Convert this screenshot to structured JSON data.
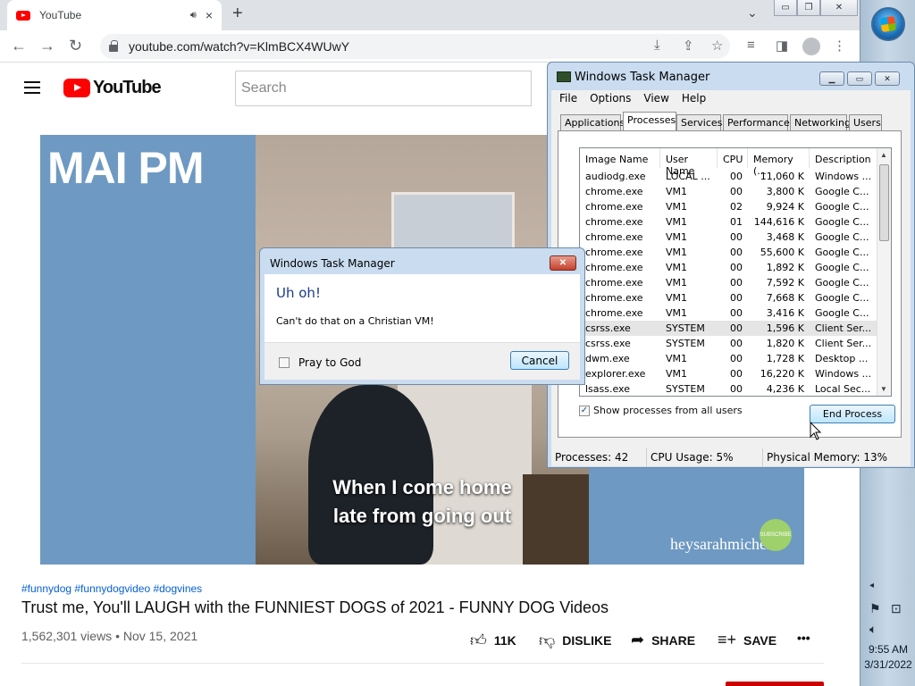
{
  "browser": {
    "tab_title": "YouTube",
    "url": "youtube.com/watch?v=KlmBCX4WUwY",
    "new_tab": "+",
    "close_tab": "×"
  },
  "youtube": {
    "logo_text": "YouTube",
    "search_placeholder": "Search",
    "video_overlay_brand": "MAI PM",
    "video_caption_line1": "When I come home",
    "video_caption_line2": "late from going out",
    "video_watermark": "heysarahmichelle",
    "video_badge": "SUBSCRIBE",
    "hashtags": "#funnydog #funnydogvideo #dogvines",
    "title": "Trust me, You'll LAUGH with the FUNNIEST DOGS of 2021 - FUNNY DOG Videos",
    "views_date": "1,562,301 views • Nov 15, 2021",
    "likes": "11K",
    "dislike": "DISLIKE",
    "share": "SHARE",
    "save": "SAVE",
    "more": "•••"
  },
  "task_manager": {
    "title": "Windows Task Manager",
    "menu": [
      "File",
      "Options",
      "View",
      "Help"
    ],
    "tabs": [
      "Applications",
      "Processes",
      "Services",
      "Performance",
      "Networking",
      "Users"
    ],
    "active_tab": "Processes",
    "columns": [
      "Image Name",
      "User Name",
      "CPU",
      "Memory (...",
      "Description"
    ],
    "rows": [
      [
        "audiodg.exe",
        "LOCAL ...",
        "00",
        "11,060 K",
        "Windows ..."
      ],
      [
        "chrome.exe",
        "VM1",
        "00",
        "3,800 K",
        "Google C..."
      ],
      [
        "chrome.exe",
        "VM1",
        "02",
        "9,924 K",
        "Google C..."
      ],
      [
        "chrome.exe",
        "VM1",
        "01",
        "144,616 K",
        "Google C..."
      ],
      [
        "chrome.exe",
        "VM1",
        "00",
        "3,468 K",
        "Google C..."
      ],
      [
        "chrome.exe",
        "VM1",
        "00",
        "55,600 K",
        "Google C..."
      ],
      [
        "chrome.exe",
        "VM1",
        "00",
        "1,892 K",
        "Google C..."
      ],
      [
        "chrome.exe",
        "VM1",
        "00",
        "7,592 K",
        "Google C..."
      ],
      [
        "chrome.exe",
        "VM1",
        "00",
        "7,668 K",
        "Google C..."
      ],
      [
        "chrome.exe",
        "VM1",
        "00",
        "3,416 K",
        "Google C..."
      ],
      [
        "csrss.exe",
        "SYSTEM",
        "00",
        "1,596 K",
        "Client Ser..."
      ],
      [
        "csrss.exe",
        "SYSTEM",
        "00",
        "1,820 K",
        "Client Ser..."
      ],
      [
        "dwm.exe",
        "VM1",
        "00",
        "1,728 K",
        "Desktop ..."
      ],
      [
        "explorer.exe",
        "VM1",
        "00",
        "16,220 K",
        "Windows ..."
      ],
      [
        "lsass.exe",
        "SYSTEM",
        "00",
        "4,236 K",
        "Local Sec..."
      ]
    ],
    "selected_row": 10,
    "show_all_label": "Show processes from all users",
    "show_all_checked": true,
    "end_process_label": "End Process",
    "status_processes": "Processes: 42",
    "status_cpu": "CPU Usage: 5%",
    "status_memory": "Physical Memory: 13%"
  },
  "dialog": {
    "title": "Windows Task Manager",
    "heading": "Uh oh!",
    "message": "Can't do that on a Christian VM!",
    "checkbox_label": "Pray to God",
    "cancel_label": "Cancel"
  },
  "taskbar": {
    "time": "9:55 AM",
    "date": "3/31/2022"
  },
  "colors": {
    "youtube_red": "#ff0000",
    "link_blue": "#065fd4",
    "dialog_heading": "#1a3a8c",
    "win7_frame": "#c9dcf0"
  }
}
